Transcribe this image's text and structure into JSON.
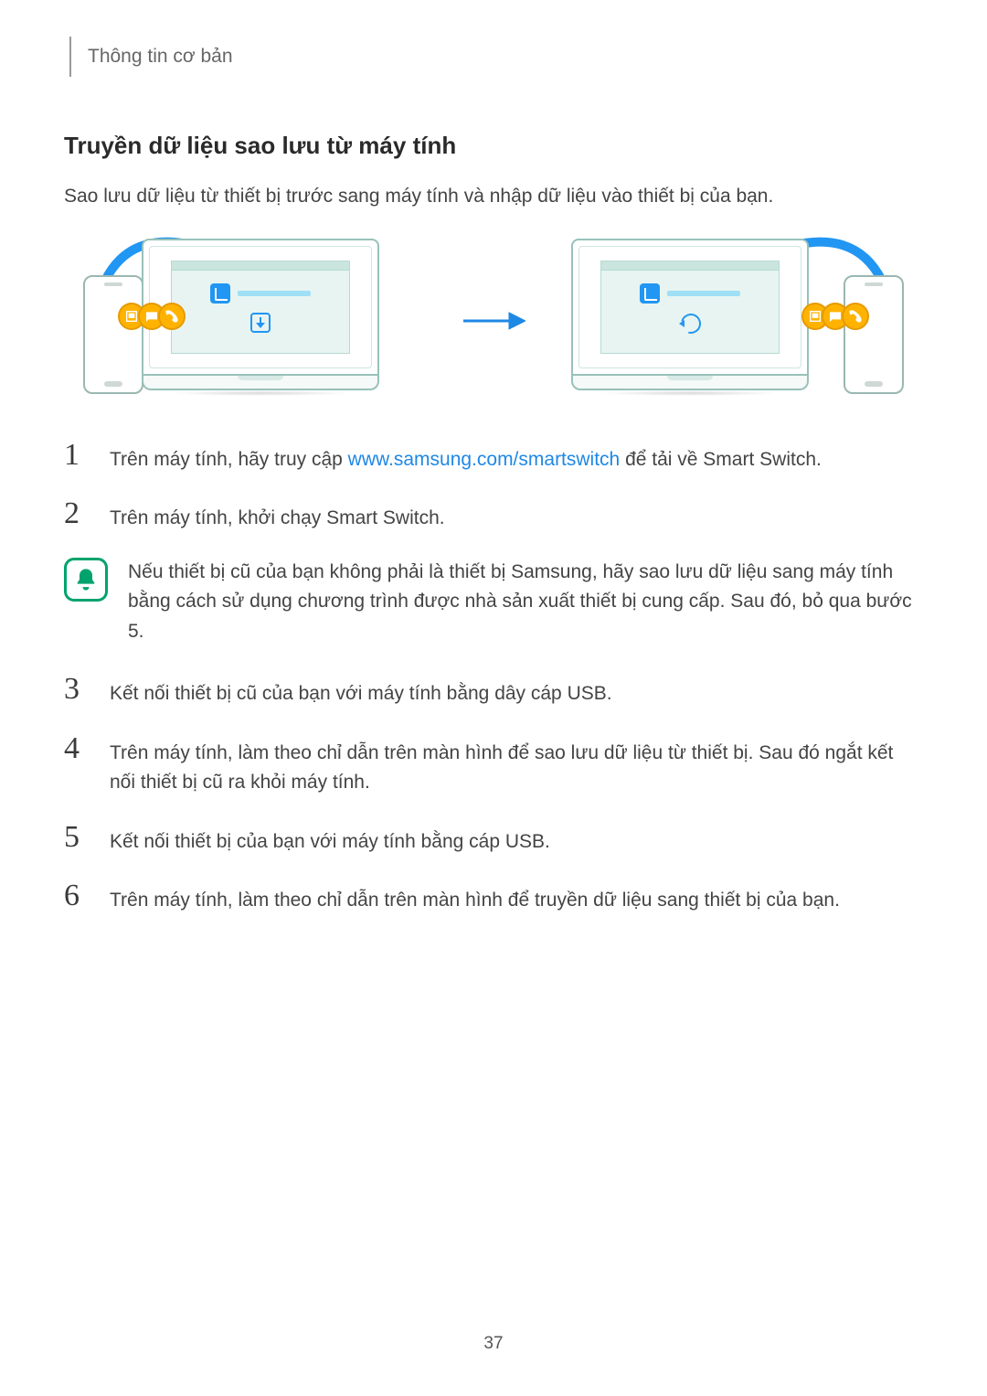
{
  "header": "Thông tin cơ bản",
  "title": "Truyền dữ liệu sao lưu từ máy tính",
  "intro": "Sao lưu dữ liệu từ thiết bị trước sang máy tính và nhập dữ liệu vào thiết bị của bạn.",
  "link_url": "www.samsung.com/smartswitch",
  "steps": {
    "s1_a": "Trên máy tính, hãy truy cập ",
    "s1_b": " để tải về Smart Switch.",
    "s2": "Trên máy tính, khởi chạy Smart Switch.",
    "s3": "Kết nối thiết bị cũ của bạn với máy tính bằng dây cáp USB.",
    "s4": "Trên máy tính, làm theo chỉ dẫn trên màn hình để sao lưu dữ liệu từ thiết bị. Sau đó ngắt kết nối thiết bị cũ ra khỏi máy tính.",
    "s5": "Kết nối thiết bị của bạn với máy tính bằng cáp USB.",
    "s6": "Trên máy tính, làm theo chỉ dẫn trên màn hình để truyền dữ liệu sang thiết bị của bạn."
  },
  "note": "Nếu thiết bị cũ của bạn không phải là thiết bị Samsung, hãy sao lưu dữ liệu sang máy tính bằng cách sử dụng chương trình được nhà sản xuất thiết bị cung cấp. Sau đó, bỏ qua bước 5.",
  "nums": {
    "n1": "1",
    "n2": "2",
    "n3": "3",
    "n4": "4",
    "n5": "5",
    "n6": "6"
  },
  "page_number": "37"
}
